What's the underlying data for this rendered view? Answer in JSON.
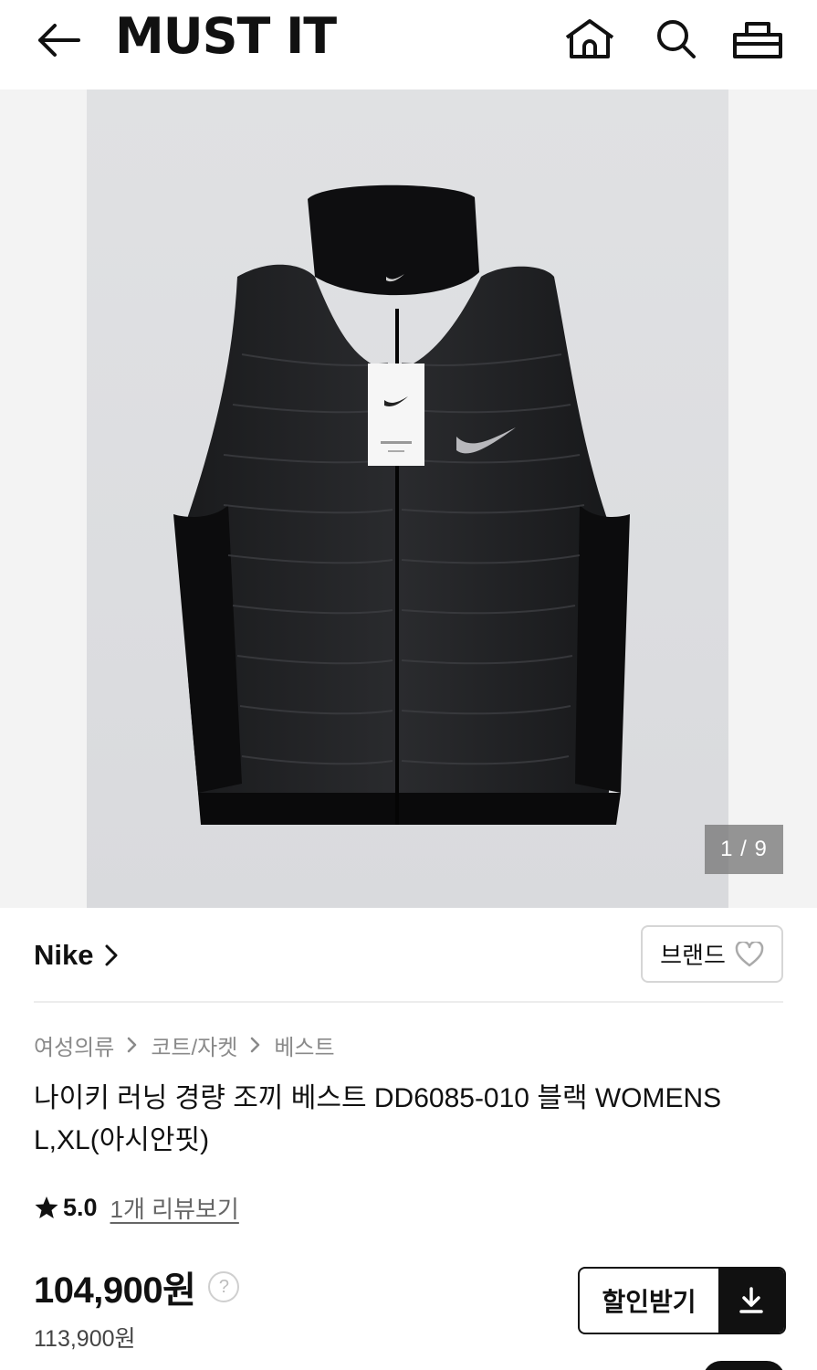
{
  "header": {
    "logo": "MUST IT",
    "icons": [
      "back-arrow-icon",
      "home-icon",
      "search-icon",
      "shopping-basket-icon"
    ]
  },
  "gallery": {
    "counter": "1 / 9"
  },
  "brand": {
    "name": "Nike",
    "fav_label": "브랜드"
  },
  "breadcrumb": [
    "여성의류",
    "코트/자켓",
    "베스트"
  ],
  "product": {
    "title": "나이키 러닝 경량 조끼 베스트 DD6085-010 블랙 WOMENS L,XL(아시안핏)"
  },
  "rating": {
    "value": "5.0",
    "review_link": "1개 리뷰보기"
  },
  "price": {
    "current": "104,900원",
    "original": "113,900원",
    "help": "?"
  },
  "coupon": {
    "label": "할인받기"
  },
  "colors": {
    "text": "#111111",
    "muted": "#8a8a8a",
    "border": "#d6d6d6",
    "accent": "#111111"
  }
}
